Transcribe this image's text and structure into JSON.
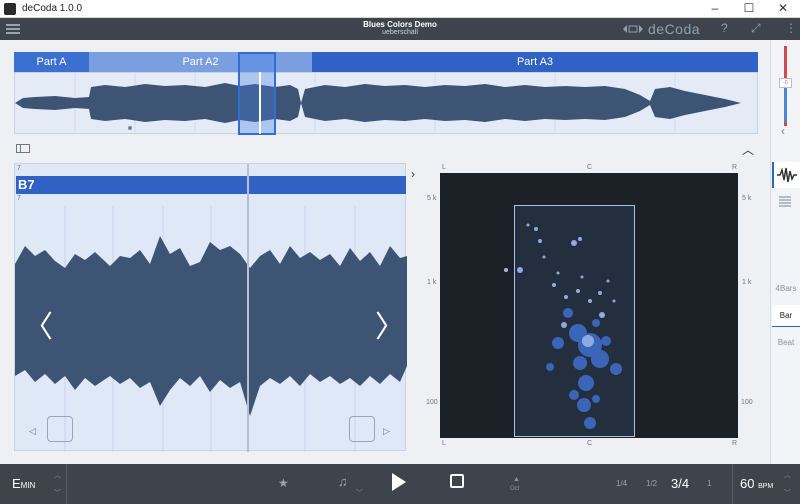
{
  "window": {
    "title": "deCoda 1.0.0",
    "controls": [
      "–",
      "☐",
      "✕"
    ]
  },
  "header": {
    "song_title": "Blues Colors Demo",
    "artist": "ueberschall",
    "brand": "deCoda",
    "help": "?",
    "fullscreen": "⤢",
    "more": "⋮"
  },
  "overview": {
    "parts": [
      {
        "label": "Part A",
        "color": "#3b6fd0"
      },
      {
        "label": "Part A2",
        "color": "#7a9fe0"
      },
      {
        "label": "Part A3",
        "color": "#2f62c4"
      }
    ]
  },
  "detail": {
    "chord": "B7",
    "bar_number_top": "7",
    "bar_number_bottom": "7",
    "prev": "〈",
    "next": "〉"
  },
  "spectrum": {
    "left_label": "L",
    "center_label": "C",
    "right_label": "R",
    "freq_labels": [
      "5 k",
      "1 k",
      "100"
    ]
  },
  "rail": {
    "volume_label": "-0",
    "quantize": [
      "4Bars",
      "Bar",
      "Beat"
    ],
    "quantize_selected": "Bar"
  },
  "transport": {
    "key": "E",
    "key_mode": "MIN",
    "octave_label": "Oct",
    "time_sigs": [
      "1/4",
      "1/2",
      "3/4",
      "1"
    ],
    "time_sig_current": "3/4",
    "tempo": "60",
    "tempo_unit": "BPM"
  }
}
